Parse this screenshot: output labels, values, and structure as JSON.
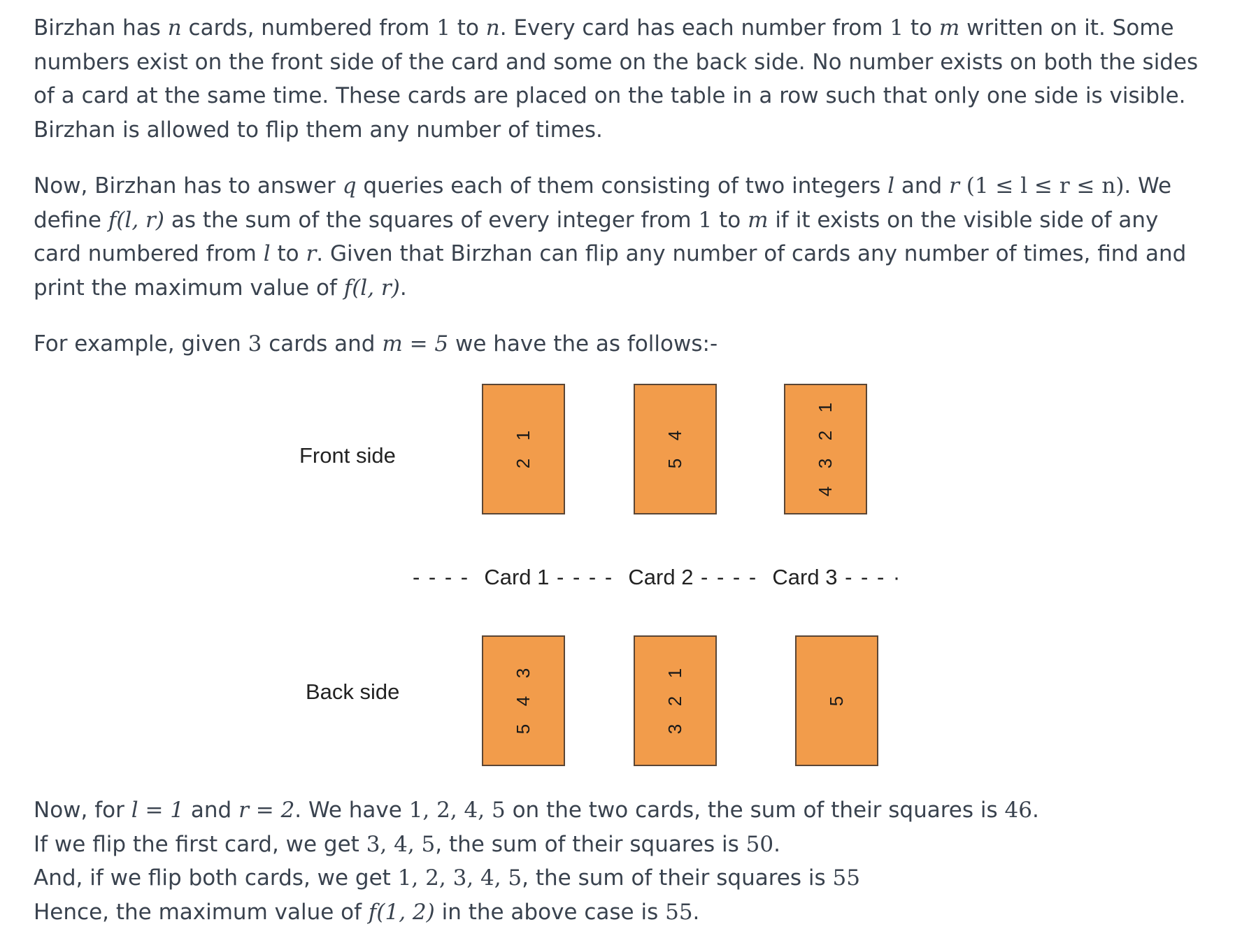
{
  "paragraph1": {
    "t1": "Birzhan has ",
    "n1": "n",
    "t2": " cards, numbered from ",
    "one1": "1",
    "t3": " to ",
    "n2": "n",
    "t4": ". Every card has each number from ",
    "one2": "1",
    "t5": " to ",
    "m1": "m",
    "t6": " written on it. Some numbers exist on the front side of the card and some on the back side. No number exists on both the sides of a card at the same time. These cards are placed on the table in a row such that only one side is visible. Birzhan is allowed to flip them any number of times."
  },
  "paragraph2": {
    "t1": "Now, Birzhan has to answer ",
    "q": "q",
    "t2": " queries each of them consisting of two integers ",
    "l1": "l",
    "t3": " and ",
    "r1": "r",
    "cond": "(1 ≤ l ≤ r ≤ n)",
    "t4": ". We define ",
    "f1": "f(l, r)",
    "t5": " as the sum of the squares of every integer from ",
    "one": "1",
    "t6": " to ",
    "m": "m",
    "t7": " if it exists on the visible side of any card numbered from ",
    "l2": "l",
    "t8": " to ",
    "r2": "r",
    "t9": ". Given that Birzhan can flip any number of cards any number of times, find and print the maximum value of ",
    "f2": "f(l, r)",
    "t10": "."
  },
  "paragraph3": {
    "t1": "For example, given ",
    "three": "3",
    "t2": " cards and ",
    "meq": "m = 5",
    "t3": " we have the as follows:-"
  },
  "figure": {
    "front_label": "Front side",
    "back_label": "Back side",
    "card1_label": "Card 1",
    "card2_label": "Card 2",
    "card3_label": "Card 3",
    "card_color": "#f29c4b",
    "front_cards": [
      [
        "1",
        "2"
      ],
      [
        "4",
        "5"
      ],
      [
        "1",
        "2",
        "3",
        "4"
      ]
    ],
    "back_cards": [
      [
        "3",
        "4",
        "5"
      ],
      [
        "1",
        "2",
        "3"
      ],
      [
        "5"
      ]
    ]
  },
  "paragraph4": {
    "line1": {
      "t1": "Now, for ",
      "l": "l = 1",
      "t2": " and ",
      "r": "r = 2",
      "t3": ". We have ",
      "vals": "1, 2, 4, 5",
      "t4": " on the two cards, the sum of their squares is ",
      "sum": "46",
      "t5": "."
    },
    "line2": {
      "t1": "If we flip the first card, we get ",
      "vals": "3, 4, 5",
      "t2": ", the sum of their squares is ",
      "sum": "50",
      "t3": "."
    },
    "line3": {
      "t1": "And, if we flip both cards, we get ",
      "vals": "1, 2, 3, 4, 5",
      "t2": ", the sum of their squares is ",
      "sum": "55"
    },
    "line4": {
      "t1": "Hence, the maximum value of ",
      "f": "f(1, 2)",
      "t2": " in the above case is ",
      "val": "55",
      "t3": "."
    }
  }
}
